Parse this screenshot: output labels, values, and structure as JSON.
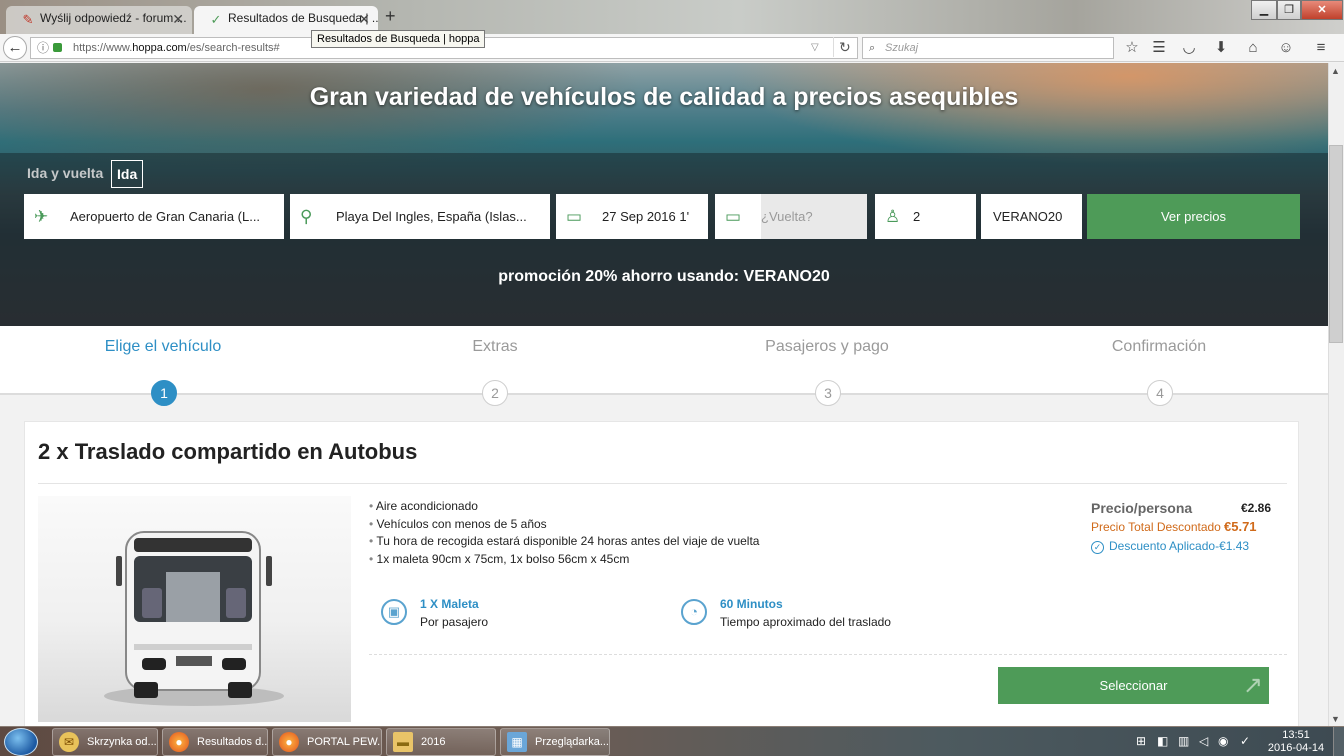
{
  "browser": {
    "tabs": [
      {
        "label": "Wyślij odpowiedź - forum ..."
      },
      {
        "label": "Resultados de Busqueda | ..."
      }
    ],
    "tooltip": "Resultados de Busqueda | hoppa",
    "url_prefix": "https://www.",
    "url_domain": "hoppa.com",
    "url_path": "/es/search-results#",
    "search_placeholder": "Szukaj"
  },
  "hero": {
    "title": "Gran variedad de vehículos de calidad a precios asequibles",
    "trip_round": "Ida y vuelta",
    "trip_oneway": "Ida",
    "from": "Aeropuerto de Gran Canaria (L...",
    "to": "Playa Del Ingles, España (Islas...",
    "date": "27 Sep 2016 1'",
    "return_placeholder": "¿Vuelta?",
    "passengers": "2",
    "promo_code": "VERANO20",
    "search_button": "Ver precios",
    "promo_text": "promoción 20% ahorro usando: VERANO20"
  },
  "steps": [
    {
      "label": "Elige el vehículo",
      "num": "1"
    },
    {
      "label": "Extras",
      "num": "2"
    },
    {
      "label": "Pasajeros y pago",
      "num": "3"
    },
    {
      "label": "Confirmación",
      "num": "4"
    }
  ],
  "vehicle": {
    "title": "2 x Traslado compartido en Autobus",
    "features": [
      "Aire acondicionado",
      "Vehículos con menos de 5 años",
      "Tu hora de recogida estará disponible 24 horas antes del viaje de vuelta",
      "1x maleta 90cm x 75cm, 1x bolso 56cm x 45cm"
    ],
    "luggage_title": "1 X Maleta",
    "luggage_sub": "Por pasajero",
    "time_title": "60 Minutos",
    "time_sub": "Tiempo aproximado del traslado",
    "price_label": "Precio/persona",
    "price_value": "€2.86",
    "total_label": "Precio Total Descontado",
    "total_value": "€5.71",
    "discount_label": "Descuento Aplicado",
    "discount_value": "-€1.43",
    "select_button": "Seleccionar"
  },
  "taskbar": {
    "items": [
      {
        "label": "Skrzynka od..."
      },
      {
        "label": "Resultados d..."
      },
      {
        "label": "PORTAL PEW..."
      },
      {
        "label": "2016"
      },
      {
        "label": "Przeglądarka..."
      }
    ],
    "time": "13:51",
    "date": "2016-04-14"
  },
  "colors": {
    "accent_green": "#4e9b58",
    "accent_blue": "#2e8fc5",
    "discount_orange": "#d06a1a"
  }
}
